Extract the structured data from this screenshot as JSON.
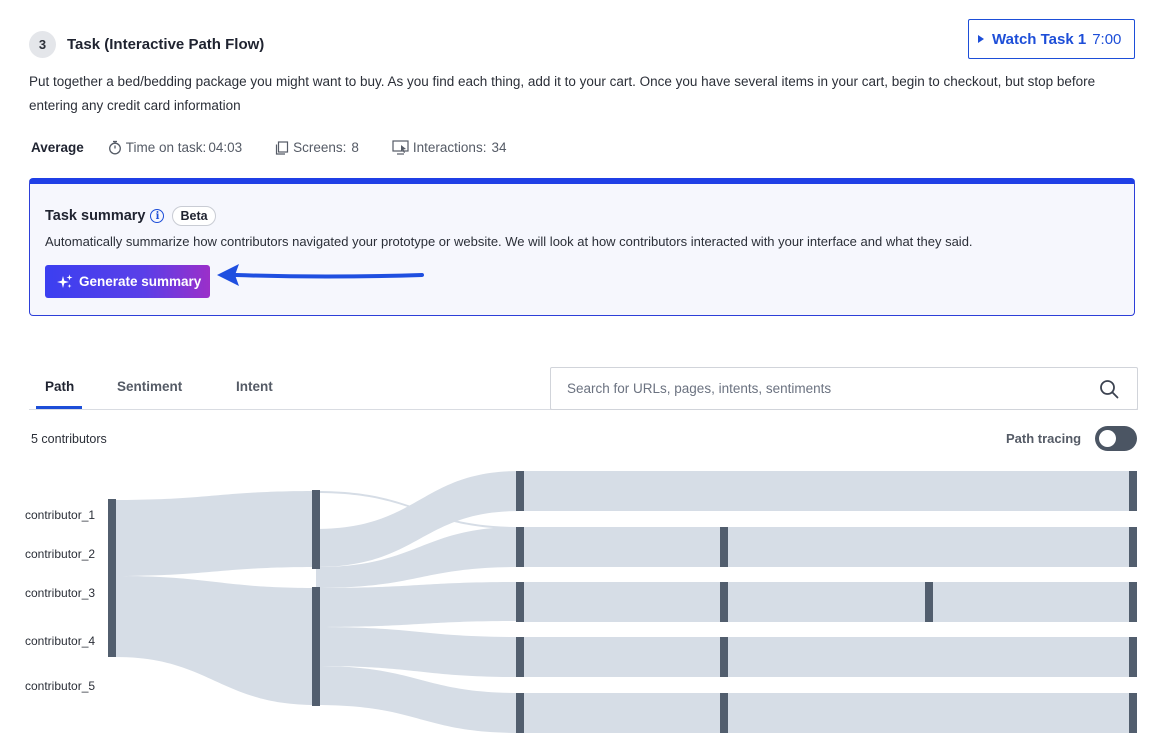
{
  "task": {
    "number": "3",
    "title": "Task (Interactive Path Flow)",
    "description": "Put together a bed/bedding package you might want to buy. As you find each thing, add it to your cart. Once you have several items in your cart, begin to checkout, but stop before entering any credit card information"
  },
  "watch_button": {
    "label": "Watch Task 1",
    "duration": "7:00"
  },
  "stats": {
    "average_label": "Average",
    "time_label": "Time on task:",
    "time_value": "04:03",
    "screens_label": "Screens:",
    "screens_value": "8",
    "interactions_label": "Interactions:",
    "interactions_value": "34"
  },
  "summary": {
    "title": "Task summary",
    "badge": "Beta",
    "description": "Automatically summarize how contributors navigated your prototype or website. We will look at how contributors interacted with your interface and what they said.",
    "button_label": "Generate summary"
  },
  "tabs": [
    "Path",
    "Sentiment",
    "Intent"
  ],
  "active_tab": "Path",
  "search": {
    "placeholder": "Search for URLs, pages, intents, sentiments"
  },
  "contributors_count": "5 contributors",
  "path_tracing": {
    "label": "Path tracing",
    "enabled": false
  },
  "flow": {
    "contributors": [
      "contributor_1",
      "contributor_2",
      "contributor_3",
      "contributor_4",
      "contributor_5"
    ]
  },
  "colors": {
    "accent": "#1d4ed8",
    "flow_band": "#d6dde6",
    "flow_node": "#525e6e",
    "toggle_off": "#4b5563"
  },
  "icons": {
    "play": "play-icon",
    "timer": "stopwatch-icon",
    "screens": "screens-icon",
    "interactions": "monitor-cursor-icon",
    "info": "info-icon",
    "sparkle": "sparkle-icon",
    "search": "search-icon"
  }
}
